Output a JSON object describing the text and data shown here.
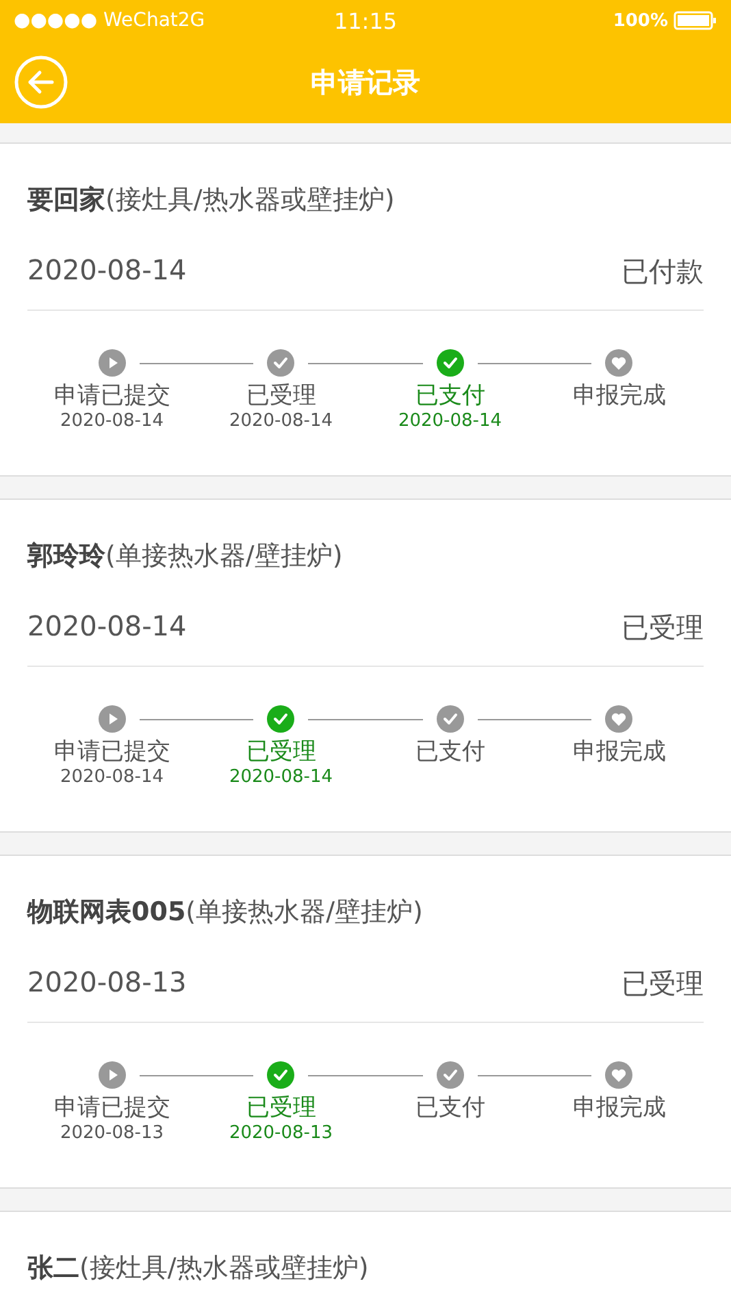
{
  "status_bar": {
    "carrier": "●●●●● WeChat2G",
    "time": "11:15",
    "battery": "100%"
  },
  "nav": {
    "title": "申请记录"
  },
  "records": [
    {
      "title": "**要回家**(接灶具/热水器或壁挂炉)",
      "date": "2020-08-14",
      "status": "已付款",
      "steps": [
        {
          "kind": "play",
          "label": "申请已提交",
          "date": "2020-08-14",
          "selected": false
        },
        {
          "kind": "check",
          "label": "已受理",
          "date": "2020-08-14",
          "selected": false
        },
        {
          "kind": "check",
          "label": "已支付",
          "date": "2020-08-14",
          "selected": true
        },
        {
          "kind": "heart",
          "label": "申报完成",
          "selected": false
        }
      ]
    },
    {
      "title": "**郭玲玲**(单接热水器/壁挂炉)",
      "date": "2020-08-14",
      "status": "已受理",
      "steps": [
        {
          "kind": "play",
          "label": "申请已提交",
          "date": "2020-08-14",
          "selected": false
        },
        {
          "kind": "check",
          "label": "已受理",
          "date": "2020-08-14",
          "selected": true
        },
        {
          "kind": "check",
          "label": "已支付",
          "selected": false
        },
        {
          "kind": "heart",
          "label": "申报完成",
          "selected": false
        }
      ]
    },
    {
      "title": "**物联网表005**(单接热水器/壁挂炉)",
      "date": "2020-08-13",
      "status": "已受理",
      "steps": [
        {
          "kind": "play",
          "label": "申请已提交",
          "date": "2020-08-13",
          "selected": false
        },
        {
          "kind": "check",
          "label": "已受理",
          "date": "2020-08-13",
          "selected": true
        },
        {
          "kind": "check",
          "label": "已支付",
          "selected": false
        },
        {
          "kind": "heart",
          "label": "申报完成",
          "selected": false
        }
      ]
    },
    {
      "title": "**张二**(接灶具/热水器或壁挂炉)"
    }
  ]
}
